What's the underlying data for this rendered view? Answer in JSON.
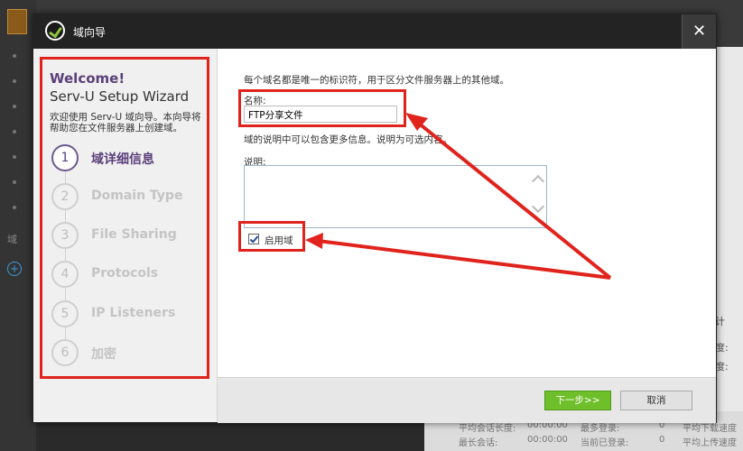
{
  "background": {
    "sidebar_domain_label": "域",
    "right_panel_texts": [
      "计",
      "度:",
      "度:"
    ],
    "bottom_rows": [
      {
        "label1": "平均会话长度:",
        "value1": "00:00:00",
        "label2": "最多登录:",
        "value2": "0",
        "label3": "平均下载速度"
      },
      {
        "label1": "最长会话:",
        "value1": "00:00:00",
        "label2": "当前已登录:",
        "value2": "0",
        "label3": "平均上传速度"
      }
    ]
  },
  "dialog": {
    "title": "域向导",
    "close_symbol": "✕"
  },
  "wizard": {
    "welcome": "Welcome!",
    "title": "Serv-U Setup Wizard",
    "description": "欢迎使用 Serv-U 域向导。本向导将帮助您在文件服务器上创建域。",
    "steps": [
      {
        "number": "1",
        "label": "域详细信息"
      },
      {
        "number": "2",
        "label": "Domain Type"
      },
      {
        "number": "3",
        "label": "File Sharing"
      },
      {
        "number": "4",
        "label": "Protocols"
      },
      {
        "number": "5",
        "label": "IP Listeners"
      },
      {
        "number": "6",
        "label": "加密"
      }
    ]
  },
  "form": {
    "intro": "每个域名都是唯一的标识符，用于区分文件服务器上的其他域。",
    "name_label": "名称:",
    "name_value": "FTP分享文件",
    "description_hint": "域的说明中可以包含更多信息。说明为可选内容。",
    "description_label": "说明:",
    "description_value": "",
    "enable_domain_label": "启用域",
    "enable_domain_checked": true
  },
  "buttons": {
    "next": "下一步>>",
    "cancel": "取消"
  },
  "colors": {
    "annotation_red": "#e0231c",
    "next_green": "#6fbf2a",
    "accent_purple": "#5b3f7a"
  }
}
